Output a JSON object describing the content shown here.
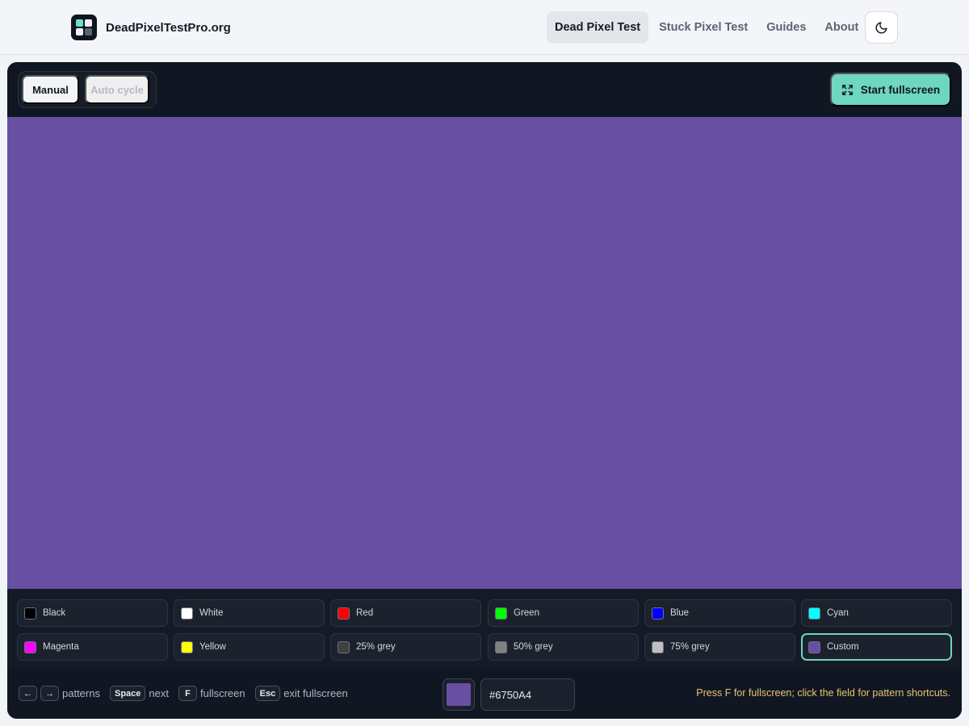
{
  "brand": {
    "name": "DeadPixelTestPro.org",
    "logo_icon": "pixel-grid-logo"
  },
  "nav": [
    {
      "label": "Dead Pixel Test",
      "active": true
    },
    {
      "label": "Stuck Pixel Test",
      "active": false
    },
    {
      "label": "Guides",
      "active": false
    },
    {
      "label": "About",
      "active": false
    }
  ],
  "theme_toggle": {
    "icon": "moon-icon"
  },
  "mode": {
    "manual_label": "Manual",
    "auto_label": "Auto cycle",
    "selected": "Manual"
  },
  "fullscreen_button": {
    "label": "Start fullscreen",
    "icon": "expand-icon"
  },
  "current_color": "#6750A4",
  "swatches": [
    {
      "label": "Black",
      "color": "#000000"
    },
    {
      "label": "White",
      "color": "#FFFFFF"
    },
    {
      "label": "Red",
      "color": "#FF0000"
    },
    {
      "label": "Green",
      "color": "#00FF00"
    },
    {
      "label": "Blue",
      "color": "#0000FF"
    },
    {
      "label": "Cyan",
      "color": "#00FFFF"
    },
    {
      "label": "Magenta",
      "color": "#FF00FF"
    },
    {
      "label": "Yellow",
      "color": "#FFFF00"
    },
    {
      "label": "25% grey",
      "color": "#404040"
    },
    {
      "label": "50% grey",
      "color": "#808080"
    },
    {
      "label": "75% grey",
      "color": "#BFBFBF"
    },
    {
      "label": "Custom",
      "color": "#6750A4",
      "selected": true
    }
  ],
  "shortcuts": {
    "left_key": "←",
    "right_key": "→",
    "arrows_text": "patterns",
    "space_key": "Space",
    "space_text": "next",
    "f_key": "F",
    "f_text": "fullscreen",
    "esc_key": "Esc",
    "esc_text": "exit fullscreen"
  },
  "custom_input": {
    "value": "#6750A4"
  },
  "hint": "Press F for fullscreen; click the field for pattern shortcuts."
}
